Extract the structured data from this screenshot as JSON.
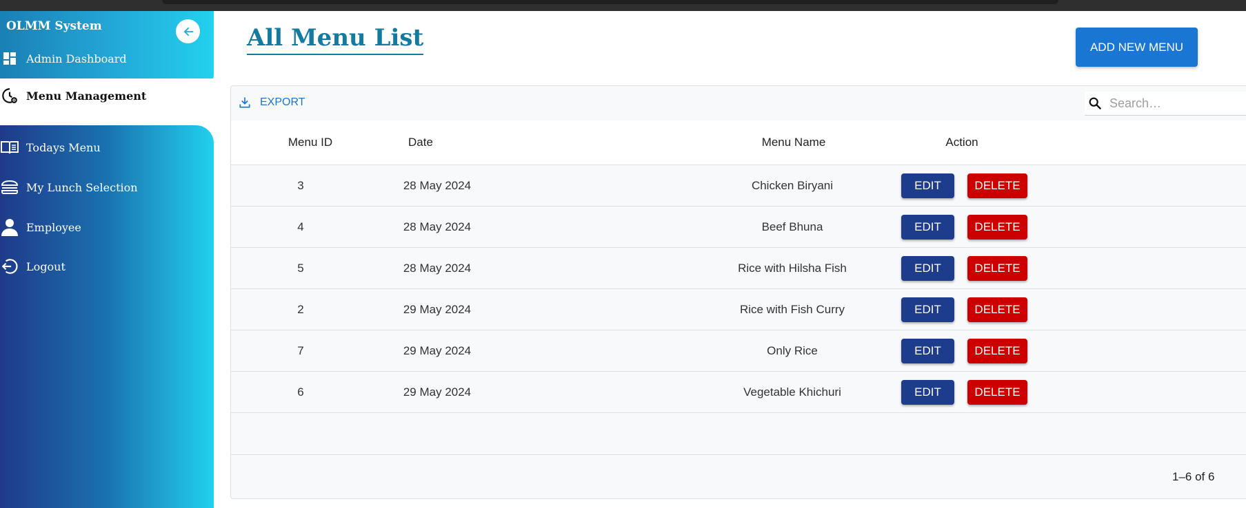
{
  "app": {
    "title": "OLMM System"
  },
  "sidebar": {
    "items": [
      {
        "label": "Admin Dashboard",
        "icon": "dashboard-icon"
      },
      {
        "label": "Menu Management",
        "icon": "menu-management-icon",
        "active": true
      },
      {
        "label": "Todays Menu",
        "icon": "book-icon"
      },
      {
        "label": "My Lunch Selection",
        "icon": "burger-icon"
      },
      {
        "label": "Employee",
        "icon": "person-icon"
      },
      {
        "label": "Logout",
        "icon": "logout-icon"
      }
    ]
  },
  "main": {
    "title": "All Menu List",
    "add_button": "ADD NEW MENU"
  },
  "grid": {
    "export_label": "EXPORT",
    "search_placeholder": "Search…",
    "columns": [
      "Menu ID",
      "Date",
      "Menu Name",
      "Action"
    ],
    "rows": [
      {
        "id": "3",
        "date": "28 May 2024",
        "name": "Chicken Biryani"
      },
      {
        "id": "4",
        "date": "28 May 2024",
        "name": "Beef Bhuna"
      },
      {
        "id": "5",
        "date": "28 May 2024",
        "name": "Rice with Hilsha Fish"
      },
      {
        "id": "2",
        "date": "29 May 2024",
        "name": "Rice with Fish Curry"
      },
      {
        "id": "7",
        "date": "29 May 2024",
        "name": "Only Rice"
      },
      {
        "id": "6",
        "date": "29 May 2024",
        "name": "Vegetable Khichuri"
      }
    ],
    "edit_label": "EDIT",
    "delete_label": "DELETE",
    "pagination": "1–6 of 6"
  },
  "colors": {
    "accent": "#1976d2",
    "title": "#137aa0",
    "edit": "#1e3c8c",
    "delete": "#cc0000"
  }
}
